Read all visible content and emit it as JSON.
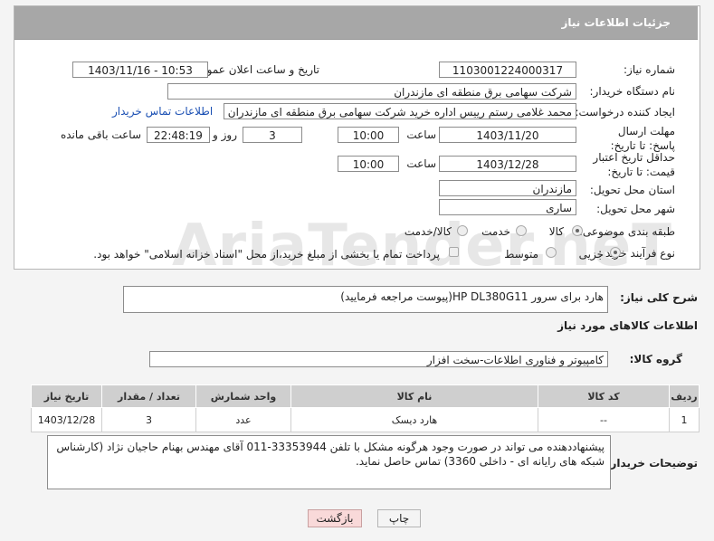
{
  "header": {
    "title": "جزئیات اطلاعات نیاز"
  },
  "fields": {
    "need_number_label": "شماره نیاز:",
    "need_number": "1103001224000317",
    "announce_label": "تاریخ و ساعت اعلان عمومی:",
    "announce_value": "1403/11/16 - 10:53",
    "buyer_label": "نام دستگاه خریدار:",
    "buyer_value": "شرکت سهامی برق منطقه ای مازندران",
    "creator_label": "ایجاد کننده درخواست:",
    "creator_value": "محمد غلامی رستم رییس اداره خرید شرکت سهامی برق منطقه ای مازندران",
    "contact_link": "اطلاعات تماس خریدار",
    "deadline_label": "مهلت ارسال پاسخ: تا تاریخ:",
    "deadline_date": "1403/11/20",
    "time_label": "ساعت",
    "deadline_time": "10:00",
    "days_value": "3",
    "days_label": "روز و",
    "remaining_time": "22:48:19",
    "remaining_label": "ساعت باقی مانده",
    "validity_label": "حداقل تاریخ اعتبار قیمت: تا تاریخ:",
    "validity_date": "1403/12/28",
    "validity_time": "10:00",
    "province_label": "استان محل تحویل:",
    "province_value": "مازندران",
    "city_label": "شهر محل تحویل:",
    "city_value": "ساری",
    "category_label": "طبقه بندی موضوعی:",
    "category_options": [
      "کالا",
      "خدمت",
      "کالا/خدمت"
    ],
    "process_label": "نوع فرآیند خرید :",
    "process_options": [
      "جزیی",
      "متوسط"
    ],
    "payment_note": "پرداخت تمام یا بخشی از مبلغ خرید،از محل \"اسناد خزانه اسلامی\" خواهد بود."
  },
  "description": {
    "label": "شرح کلی نیاز:",
    "value": "هارد برای سرور HP DL380G11(پیوست مراجعه فرمایید)"
  },
  "goods": {
    "section_title": "اطلاعات کالاهای مورد نیاز",
    "group_label": "گروه کالا:",
    "group_value": "کامپیوتر و فناوری اطلاعات-سخت افزار",
    "columns": [
      "ردیف",
      "کد کالا",
      "نام کالا",
      "واحد شمارش",
      "تعداد / مقدار",
      "تاریخ نیاز"
    ],
    "rows": [
      {
        "row": "1",
        "code": "--",
        "name": "هارد دیسک",
        "unit": "عدد",
        "qty": "3",
        "date": "1403/12/28"
      }
    ]
  },
  "buyer_notes": {
    "label": "توضیحات خریدار:",
    "value": "پیشنهاددهنده می تواند در صورت وجود هرگونه مشکل با تلفن 33353944-011 آقای مهندس بهنام حاجیان نژاد  (کارشناس شبکه های رایانه ای - داخلی 3360) تماس حاصل نماید."
  },
  "buttons": {
    "print": "چاپ",
    "back": "بازگشت"
  },
  "watermark": "AriaTender.neT",
  "colors": {
    "header_bg": "#a7a7a7",
    "link": "#1a4fb3",
    "back_button_bg": "#f9d9d9"
  }
}
